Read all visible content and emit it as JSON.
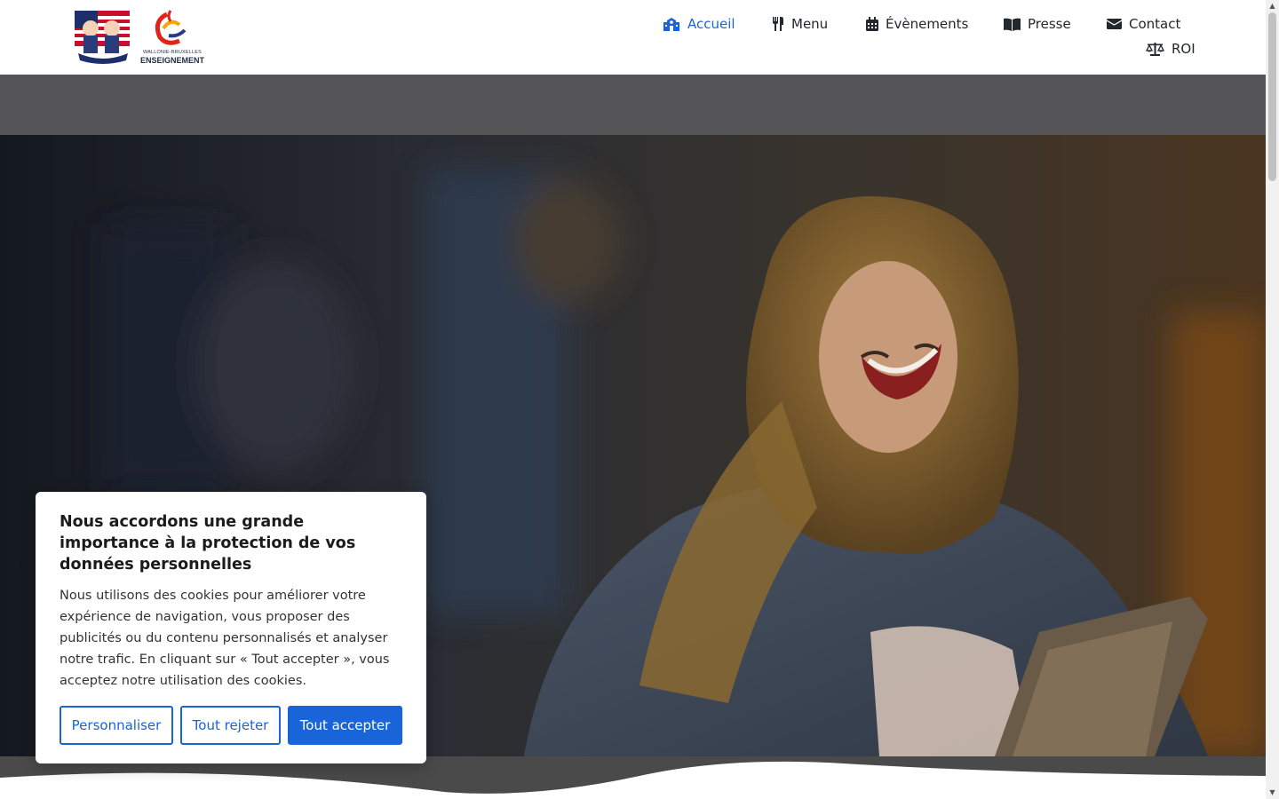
{
  "header": {
    "logo_small_text": "WALLONIE-BRUXELLES",
    "logo_big_text": "ENSEIGNEMENT"
  },
  "nav": {
    "items": [
      {
        "label": "Accueil",
        "icon": "school-icon",
        "active": true
      },
      {
        "label": "Menu",
        "icon": "utensils-icon",
        "active": false
      },
      {
        "label": "Évènements",
        "icon": "calendar-icon",
        "active": false
      },
      {
        "label": "Presse",
        "icon": "book-icon",
        "active": false
      },
      {
        "label": "Contact",
        "icon": "envelope-icon",
        "active": false
      },
      {
        "label": "ROI",
        "icon": "scale-icon",
        "active": false
      }
    ]
  },
  "cookie": {
    "title": "Nous accordons une grande importance à la protection de vos données personnelles",
    "text": "Nous utilisons des cookies pour améliorer votre expérience de navigation, vous proposer des publicités ou du contenu personnalisés et analyser notre trafic. En cliquant sur « Tout accepter », vous acceptez notre utilisation des cookies.",
    "customize_label": "Personnaliser",
    "reject_label": "Tout rejeter",
    "accept_label": "Tout accepter"
  },
  "colors": {
    "accent": "#1a64d9",
    "band": "#555557",
    "wave_dark": "#4a4a4b"
  }
}
